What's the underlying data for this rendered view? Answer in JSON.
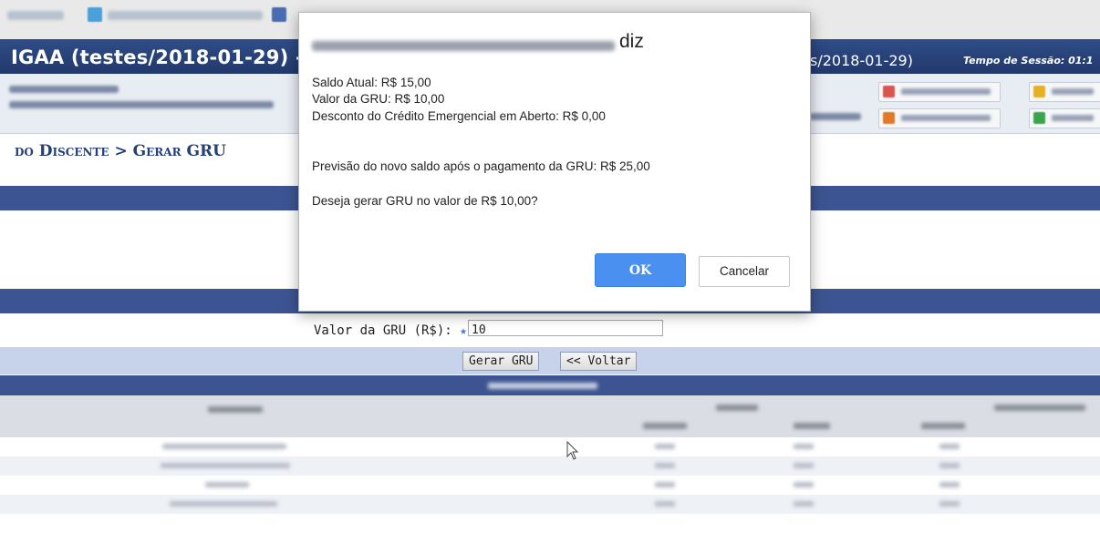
{
  "app": {
    "title": "IGAA (testes/2018-01-29) -",
    "title_right": "s/2018-01-29)",
    "session_label": "Tempo de Sessão: 01:1"
  },
  "breadcrumb": "do Discente > Gerar GRU",
  "form": {
    "field_label": "Valor da GRU (R$):",
    "required_marker": "★",
    "field_value": "10"
  },
  "buttons": {
    "generate": "Gerar GRU",
    "back": "<< Voltar"
  },
  "dialog": {
    "origin_suffix": "diz",
    "lines": [
      "Saldo Atual: R$ 15,00",
      "Valor da GRU: R$ 10,00",
      "Desconto do Crédito Emergencial em Aberto: R$ 0,00",
      "Previsão do novo saldo após o pagamento da GRU: R$ 25,00",
      "Deseja gerar GRU no valor de R$ 10,00?"
    ],
    "ok_label": "OK",
    "cancel_label": "Cancelar"
  },
  "colors": {
    "header_blue": "#2f4d88",
    "band_blue": "#3c5491",
    "ok_blue": "#4a90f0"
  }
}
